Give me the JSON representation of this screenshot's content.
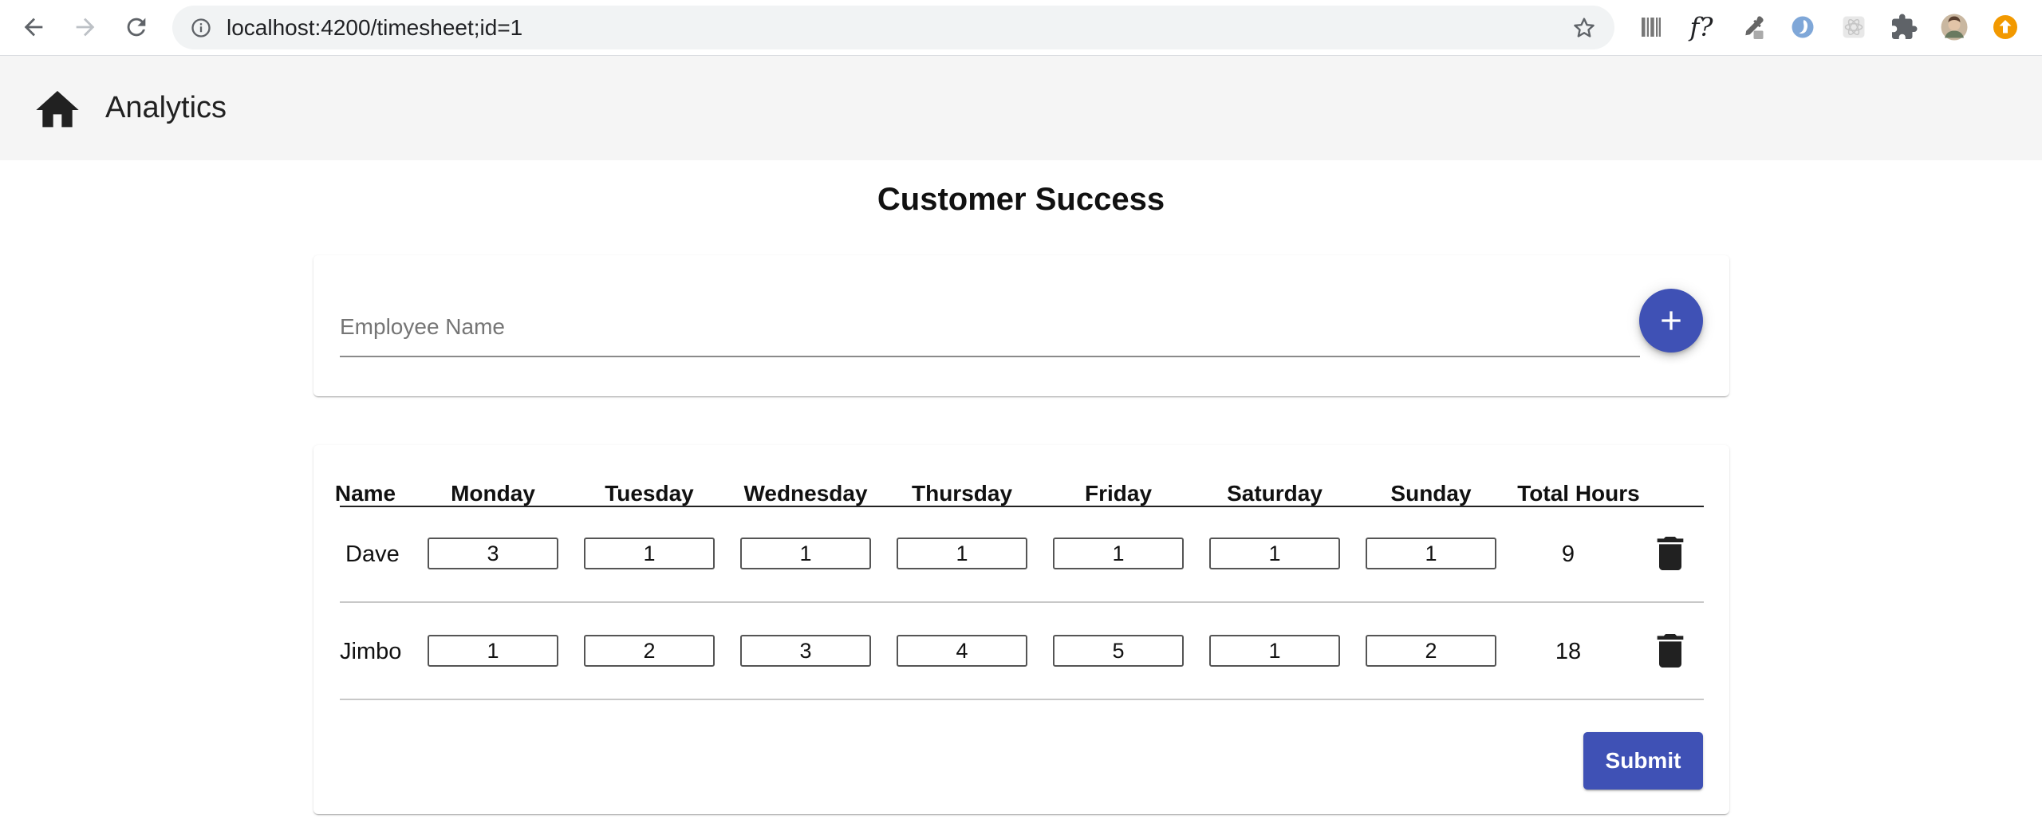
{
  "browser": {
    "url": "localhost:4200/timesheet;id=1",
    "extensions": [
      "barcode-icon",
      "font-finder-icon",
      "eyedropper-icon",
      "blue-extension-icon",
      "react-devtools-icon",
      "extensions-puzzle-icon",
      "profile-avatar",
      "update-icon"
    ],
    "ext_font_label": "f?"
  },
  "toolbar": {
    "title": "Analytics",
    "home_icon": "home-icon"
  },
  "page": {
    "title": "Customer Success"
  },
  "add_employee": {
    "placeholder": "Employee Name",
    "value": "",
    "add_icon": "plus-icon"
  },
  "table": {
    "headers": [
      "Name",
      "Monday",
      "Tuesday",
      "Wednesday",
      "Thursday",
      "Friday",
      "Saturday",
      "Sunday",
      "Total Hours"
    ],
    "rows": [
      {
        "name": "Dave",
        "hours": [
          "3",
          "1",
          "1",
          "1",
          "1",
          "1",
          "1"
        ],
        "total": "9"
      },
      {
        "name": "Jimbo",
        "hours": [
          "1",
          "2",
          "3",
          "4",
          "5",
          "1",
          "2"
        ],
        "total": "18"
      }
    ]
  },
  "actions": {
    "submit_label": "Submit"
  },
  "colors": {
    "primary": "#3f51b5",
    "toolbar_bg": "#f5f5f5",
    "update_badge": "#f29900"
  }
}
